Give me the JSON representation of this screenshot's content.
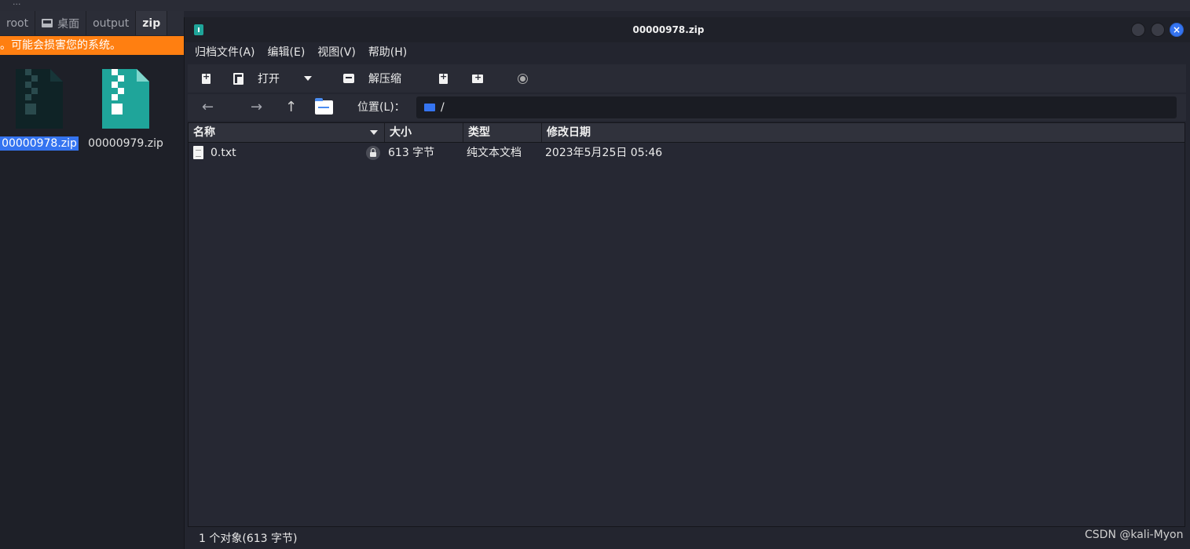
{
  "background": {
    "menubar_fragment": "...",
    "tabs": [
      {
        "label": "root"
      },
      {
        "label": "桌面"
      },
      {
        "label": "output"
      },
      {
        "label": "zip"
      }
    ],
    "warning_text": "。可能会损害您的系统。",
    "files": [
      {
        "name": "00000978.zip",
        "selected": true
      },
      {
        "name": "00000979.zip",
        "selected": false
      }
    ]
  },
  "window": {
    "title": "00000978.zip",
    "menu": [
      "归档文件(A)",
      "编辑(E)",
      "视图(V)",
      "帮助(H)"
    ],
    "toolbar": {
      "open_label": "打开",
      "extract_label": "解压缩"
    },
    "location": {
      "label": "位置(L)：",
      "path": "/"
    },
    "columns": [
      "名称",
      "大小",
      "类型",
      "修改日期"
    ],
    "rows": [
      {
        "name": "0.txt",
        "size": "613 字节",
        "type": "纯文本文档",
        "modified": "2023年5月25日 05:46",
        "locked": true
      }
    ],
    "status": "1 个对象(613 字节)"
  },
  "watermark": "CSDN @kali-Myon",
  "colors": {
    "accent": "#3574f0",
    "warning": "#ff7f11",
    "zip_icon": "#1fa59a"
  }
}
